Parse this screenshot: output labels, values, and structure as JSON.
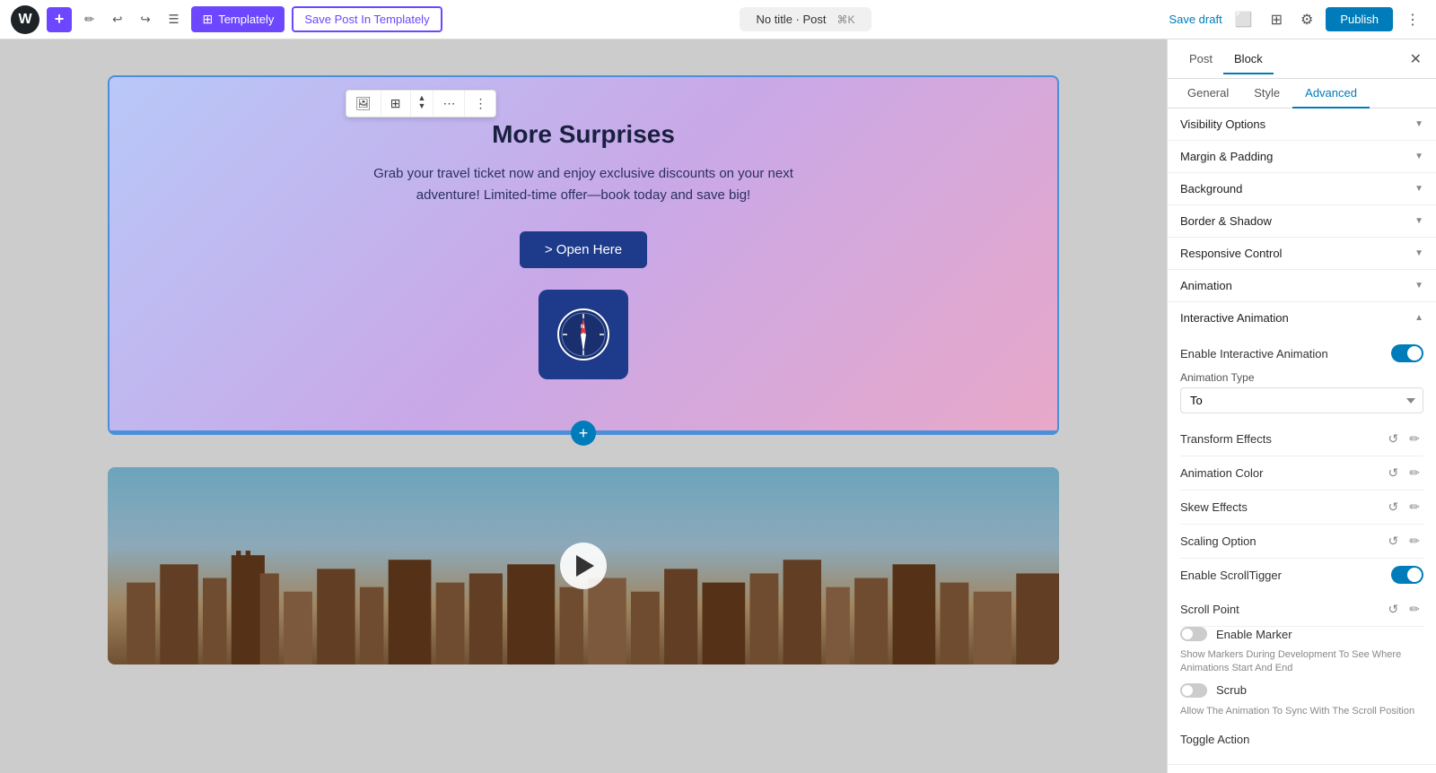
{
  "topbar": {
    "logo": "W",
    "add_btn": "+",
    "pencil_btn": "✏",
    "undo_btn": "↩",
    "redo_btn": "↪",
    "list_btn": "☰",
    "templately_btn": "Templately",
    "save_post_btn": "Save Post In Templately",
    "title": "No title · Post",
    "shortcut": "⌘K",
    "save_draft_btn": "Save draft",
    "publish_btn": "Publish"
  },
  "block_toolbar": {
    "btn1": "🖼",
    "btn2": "⊞",
    "btn3_up": "▲",
    "btn3_dn": "▼",
    "btn4": "⋯",
    "btn5": "≡",
    "btn6": "⋮"
  },
  "hero": {
    "title": "More Surprises",
    "description": "Grab your travel ticket now and enjoy exclusive discounts on your next adventure! Limited-time offer—book today and save big!",
    "button_label": "> Open Here",
    "add_block_label": "+"
  },
  "sidebar": {
    "tab_post": "Post",
    "tab_block": "Block",
    "subtab_general": "General",
    "subtab_style": "Style",
    "subtab_advanced": "Advanced",
    "sections": {
      "visibility_options": "Visibility Options",
      "margin_padding": "Margin & Padding",
      "background": "Background",
      "border_shadow": "Border & Shadow",
      "responsive_control": "Responsive Control",
      "animation": "Animation",
      "interactive_animation": "Interactive Animation"
    },
    "interactive_animation": {
      "enable_label": "Enable Interactive Animation",
      "animation_type_label": "Animation Type",
      "animation_type_value": "To",
      "transform_effects_label": "Transform Effects",
      "animation_color_label": "Animation Color",
      "skew_effects_label": "Skew Effects",
      "scaling_option_label": "Scaling Option",
      "enable_scrolltrigger_label": "Enable ScrollTigger",
      "scroll_point_label": "Scroll Point",
      "enable_marker_label": "Enable Marker",
      "enable_marker_desc": "Show Markers During Development To See Where Animations Start And End",
      "scrub_label": "Scrub",
      "scrub_desc": "Allow The Animation To Sync With The Scroll Position",
      "toggle_action_label": "Toggle Action"
    }
  }
}
